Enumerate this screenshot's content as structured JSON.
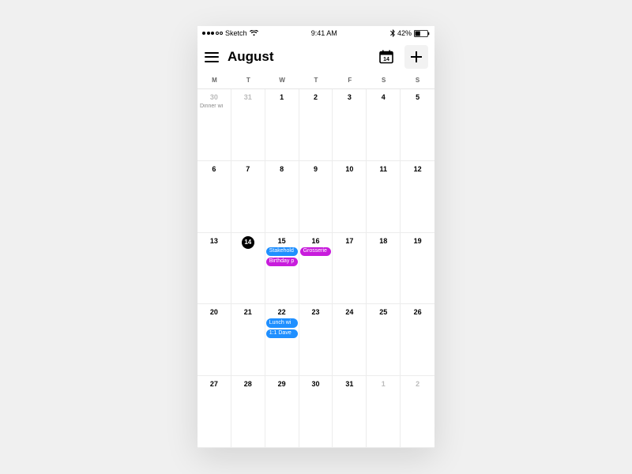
{
  "statusbar": {
    "carrier": "Sketch",
    "time": "9:41 AM",
    "battery_pct": "42%"
  },
  "header": {
    "month": "August",
    "today_date": "14"
  },
  "weekdays": [
    "M",
    "T",
    "W",
    "T",
    "F",
    "S",
    "S"
  ],
  "colors": {
    "blue": "#1f8fff",
    "magenta": "#c81cdc"
  },
  "cells": [
    {
      "num": "30",
      "muted": true,
      "events": [
        {
          "label": "Dinner wi",
          "text_only": true
        }
      ]
    },
    {
      "num": "31",
      "muted": true
    },
    {
      "num": "1"
    },
    {
      "num": "2"
    },
    {
      "num": "3"
    },
    {
      "num": "4"
    },
    {
      "num": "5"
    },
    {
      "num": "6"
    },
    {
      "num": "7"
    },
    {
      "num": "8"
    },
    {
      "num": "9"
    },
    {
      "num": "10"
    },
    {
      "num": "11"
    },
    {
      "num": "12"
    },
    {
      "num": "13"
    },
    {
      "num": "14",
      "today": true
    },
    {
      "num": "15",
      "events": [
        {
          "label": "Stakehold",
          "color": "blue"
        },
        {
          "label": "Birthday p",
          "color": "magenta"
        }
      ]
    },
    {
      "num": "16",
      "events": [
        {
          "label": "Grosserie",
          "color": "magenta"
        }
      ]
    },
    {
      "num": "17"
    },
    {
      "num": "18"
    },
    {
      "num": "19"
    },
    {
      "num": "20"
    },
    {
      "num": "21"
    },
    {
      "num": "22",
      "events": [
        {
          "label": "Lunch wi",
          "color": "blue"
        },
        {
          "label": "1:1 Dave",
          "color": "blue"
        }
      ]
    },
    {
      "num": "23"
    },
    {
      "num": "24"
    },
    {
      "num": "25"
    },
    {
      "num": "26"
    },
    {
      "num": "27"
    },
    {
      "num": "28"
    },
    {
      "num": "29"
    },
    {
      "num": "30"
    },
    {
      "num": "31"
    },
    {
      "num": "1",
      "muted": true
    },
    {
      "num": "2",
      "muted": true
    }
  ]
}
